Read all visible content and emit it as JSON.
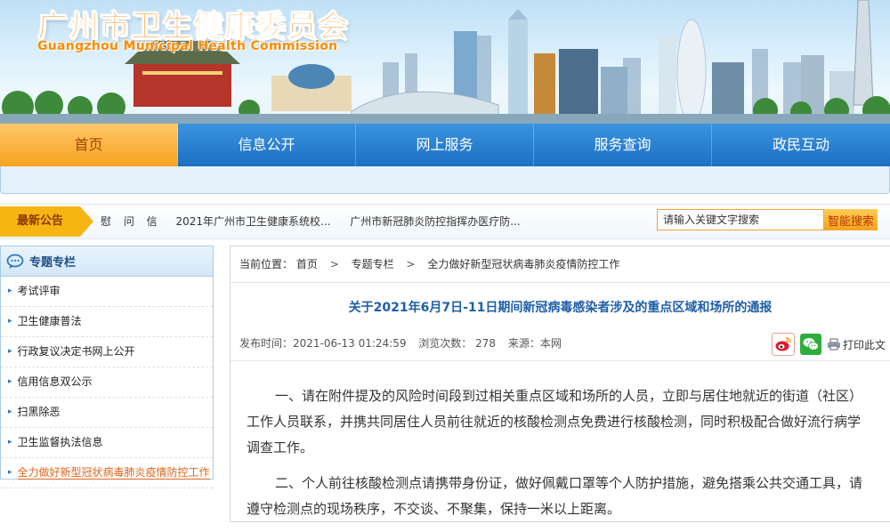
{
  "header": {
    "title": "广州市卫生健康委员会",
    "subtitle": "Guangzhou Municipal Health Commission"
  },
  "nav": {
    "items": [
      {
        "label": "首页",
        "active": true
      },
      {
        "label": "信息公开",
        "active": false
      },
      {
        "label": "网上服务",
        "active": false
      },
      {
        "label": "服务查询",
        "active": false
      },
      {
        "label": "政民互动",
        "active": false
      }
    ]
  },
  "notice": {
    "label": "最新公告",
    "items": [
      "慰 问 信",
      "2021年广州市卫生健康系统校...",
      "广州市新冠肺炎防控指挥办医疗防..."
    ]
  },
  "search": {
    "placeholder": "请输入关键文字搜索",
    "button_label": "智能搜索"
  },
  "sidebar": {
    "title": "专题专栏",
    "items": [
      {
        "label": "考试评审"
      },
      {
        "label": "卫生健康普法"
      },
      {
        "label": "行政复议决定书网上公开"
      },
      {
        "label": "信用信息双公示"
      },
      {
        "label": "扫黑除恶"
      },
      {
        "label": "卫生监督执法信息"
      },
      {
        "label": "全力做好新型冠状病毒肺炎疫情防控工作"
      }
    ]
  },
  "breadcrumb": {
    "prefix": "当前位置：",
    "items": [
      "首页",
      "专题专栏",
      "全力做好新型冠状病毒肺炎疫情防控工作"
    ]
  },
  "article": {
    "title": "关于2021年6月7日-11日期间新冠病毒感染者涉及的重点区域和场所的通报",
    "meta": {
      "published_label": "发布时间：",
      "published": "2021-06-13 01:24:59",
      "views_label": "浏览次数：",
      "views": "278",
      "source_label": "来源：",
      "source": "本网"
    },
    "print_label": "打印此文",
    "paragraphs": [
      "一、请在附件提及的风险时间段到过相关重点区域和场所的人员，立即与居住地就近的街道（社区）工作人员联系，并携共同居住人员前往就近的核酸检测点免费进行核酸检测，同时积极配合做好流行病学调查工作。",
      "二、个人前往核酸检测点请携带身份证，做好佩戴口罩等个人防护措施，避免搭乘公共交通工具，请遵守检测点的现场秩序，不交谈、不聚集，保持一米以上距离。"
    ]
  },
  "colors": {
    "nav_blue": "#1d6fc4",
    "nav_active": "#f7a21f",
    "title_orange": "#ff8a00",
    "article_title_blue": "#1f5fa8",
    "sidebar_active": "#e0651b"
  }
}
